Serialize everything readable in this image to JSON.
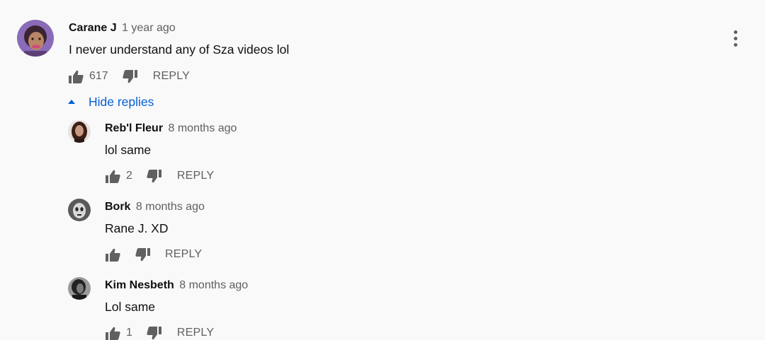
{
  "colors": {
    "background": "#f9f9f9",
    "accent": "#065fd4",
    "icon": "#606060"
  },
  "thread": {
    "author": "Carane J",
    "time": "1 year ago",
    "text": "I never understand any of Sza videos lol",
    "likes": "617",
    "reply_label": "REPLY",
    "menu_icon": "more-vert-icon",
    "hide_replies_label": "Hide replies",
    "hide_replies_icon": "caret-up-icon"
  },
  "replies": [
    {
      "author": "Reb'l Fleur",
      "time": "8 months ago",
      "text": "lol same",
      "likes": "2",
      "reply_label": "REPLY"
    },
    {
      "author": "Bork",
      "time": "8 months ago",
      "text": "Rane J. XD",
      "likes": "",
      "reply_label": "REPLY"
    },
    {
      "author": "Kim Nesbeth",
      "time": "8 months ago",
      "text": "Lol same",
      "likes": "1",
      "reply_label": "REPLY"
    }
  ]
}
